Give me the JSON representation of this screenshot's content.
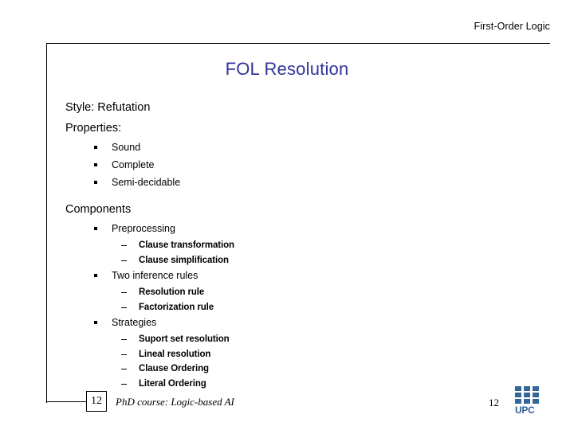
{
  "header": {
    "course_header": "First-Order Logic"
  },
  "title": "FOL Resolution",
  "content": {
    "style_line": "Style: Refutation",
    "properties_heading": "Properties:",
    "properties": [
      "Sound",
      "Complete",
      "Semi-decidable"
    ],
    "components_heading": "Components",
    "components": [
      {
        "label": "Preprocessing",
        "sub": [
          "Clause transformation",
          "Clause simplification"
        ]
      },
      {
        "label": "Two inference rules",
        "sub": [
          "Resolution rule",
          "Factorization rule"
        ]
      },
      {
        "label": "Strategies",
        "sub": [
          "Suport set resolution",
          "Lineal resolution",
          "Clause Ordering",
          "Literal Ordering"
        ]
      }
    ]
  },
  "footer": {
    "slide_box_number": "12",
    "course": "PhD course: Logic-based AI",
    "page_number": "12",
    "logo_text": "UPC"
  },
  "colors": {
    "title": "#333399",
    "logo_blue": "#336699",
    "text": "#000000"
  }
}
